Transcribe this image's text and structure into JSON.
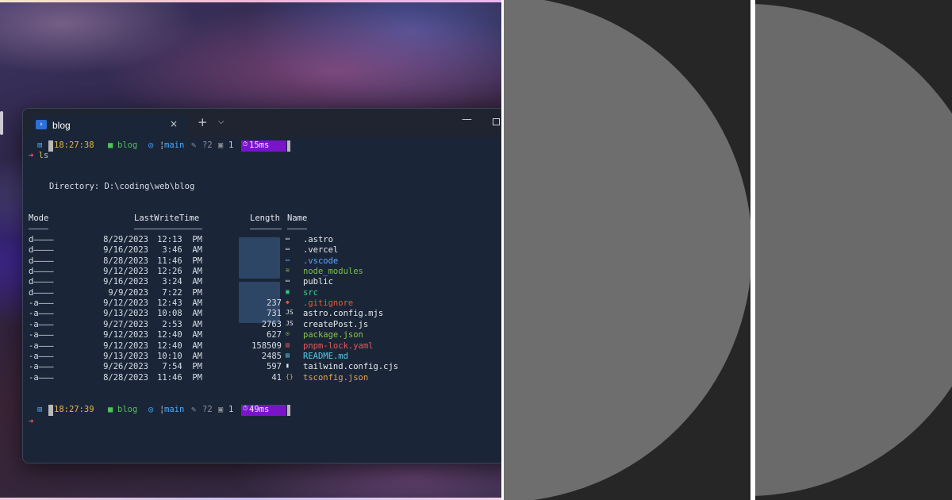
{
  "terminal": {
    "tab_title": "blog",
    "tab_icon": "powershell-icon",
    "close_glyph": "×",
    "new_tab_glyph": "+",
    "dropdown_glyph": "⌄",
    "minimize_glyph": "—",
    "prompt1": {
      "time": "18:27:38",
      "folder": "blog",
      "branch": "main",
      "untracked": "?2",
      "stash": "1",
      "duration": "15ms"
    },
    "command": "ls",
    "prompt_arrow": "➜",
    "directory_line": "Directory: D:\\coding\\web\\blog",
    "headers": {
      "mode": "Mode",
      "lastwritetime": "LastWriteTime",
      "length": "Length",
      "name": "Name"
    },
    "files": [
      {
        "mode": "d————",
        "date": "8/29/2023",
        "time": "12:13  PM",
        "length": "",
        "name": ".astro",
        "icon": "folder-icon",
        "color": "#e6e9ef"
      },
      {
        "mode": "d————",
        "date": "9/16/2023",
        "time": "3:46  AM",
        "length": "",
        "name": ".vercel",
        "icon": "folder-icon",
        "color": "#e6e9ef"
      },
      {
        "mode": "d————",
        "date": "8/28/2023",
        "time": "11:46  PM",
        "length": "",
        "name": ".vscode",
        "icon": "vscode-folder-icon",
        "color": "#59a8ff"
      },
      {
        "mode": "d————",
        "date": "9/12/2023",
        "time": "12:26  AM",
        "length": "",
        "name": "node_modules",
        "icon": "node-folder-icon",
        "color": "#7fbf4a"
      },
      {
        "mode": "d————",
        "date": "9/16/2023",
        "time": "3:24  AM",
        "length": "",
        "name": "public",
        "icon": "folder-icon",
        "color": "#e6e9ef"
      },
      {
        "mode": "d————",
        "date": "9/9/2023",
        "time": "7:22  PM",
        "length": "",
        "name": "src",
        "icon": "src-folder-icon",
        "color": "#3fcf8e"
      },
      {
        "mode": "-a———",
        "date": "9/12/2023",
        "time": "12:43  AM",
        "length": "237",
        "name": ".gitignore",
        "icon": "git-icon",
        "color": "#f0533b"
      },
      {
        "mode": "-a———",
        "date": "9/13/2023",
        "time": "10:08  AM",
        "length": "731",
        "name": "astro.config.mjs",
        "icon": "js-icon",
        "color": "#e6e9ef"
      },
      {
        "mode": "-a———",
        "date": "9/27/2023",
        "time": "2:53  AM",
        "length": "2763",
        "name": "createPost.js",
        "icon": "js-icon",
        "color": "#e6e9ef"
      },
      {
        "mode": "-a———",
        "date": "9/12/2023",
        "time": "12:40  AM",
        "length": "627",
        "name": "package.json",
        "icon": "npm-icon",
        "color": "#8bc34a"
      },
      {
        "mode": "-a———",
        "date": "9/12/2023",
        "time": "12:40  AM",
        "length": "158509",
        "name": "pnpm-lock.yaml",
        "icon": "yaml-icon",
        "color": "#e05a5a"
      },
      {
        "mode": "-a———",
        "date": "9/13/2023",
        "time": "10:10  AM",
        "length": "2485",
        "name": "README.md",
        "icon": "markdown-icon",
        "color": "#59c7e8"
      },
      {
        "mode": "-a———",
        "date": "9/26/2023",
        "time": "7:54  PM",
        "length": "597",
        "name": "tailwind.config.cjs",
        "icon": "file-icon",
        "color": "#e6e9ef"
      },
      {
        "mode": "-a———",
        "date": "8/28/2023",
        "time": "11:46  PM",
        "length": "41",
        "name": "tsconfig.json",
        "icon": "json-icon",
        "color": "#e0a64a"
      }
    ],
    "prompt2": {
      "time": "18:27:39",
      "folder": "blog",
      "branch": "main",
      "untracked": "?2",
      "stash": "1",
      "duration": "49ms"
    }
  },
  "colors": {
    "terminal_bg": "#1a2637",
    "duration_badge": "#7a14c8",
    "time": "#e6b450",
    "folder": "#53c05a",
    "branch": "#4aa8ff",
    "arrow": "#ff5f67"
  }
}
